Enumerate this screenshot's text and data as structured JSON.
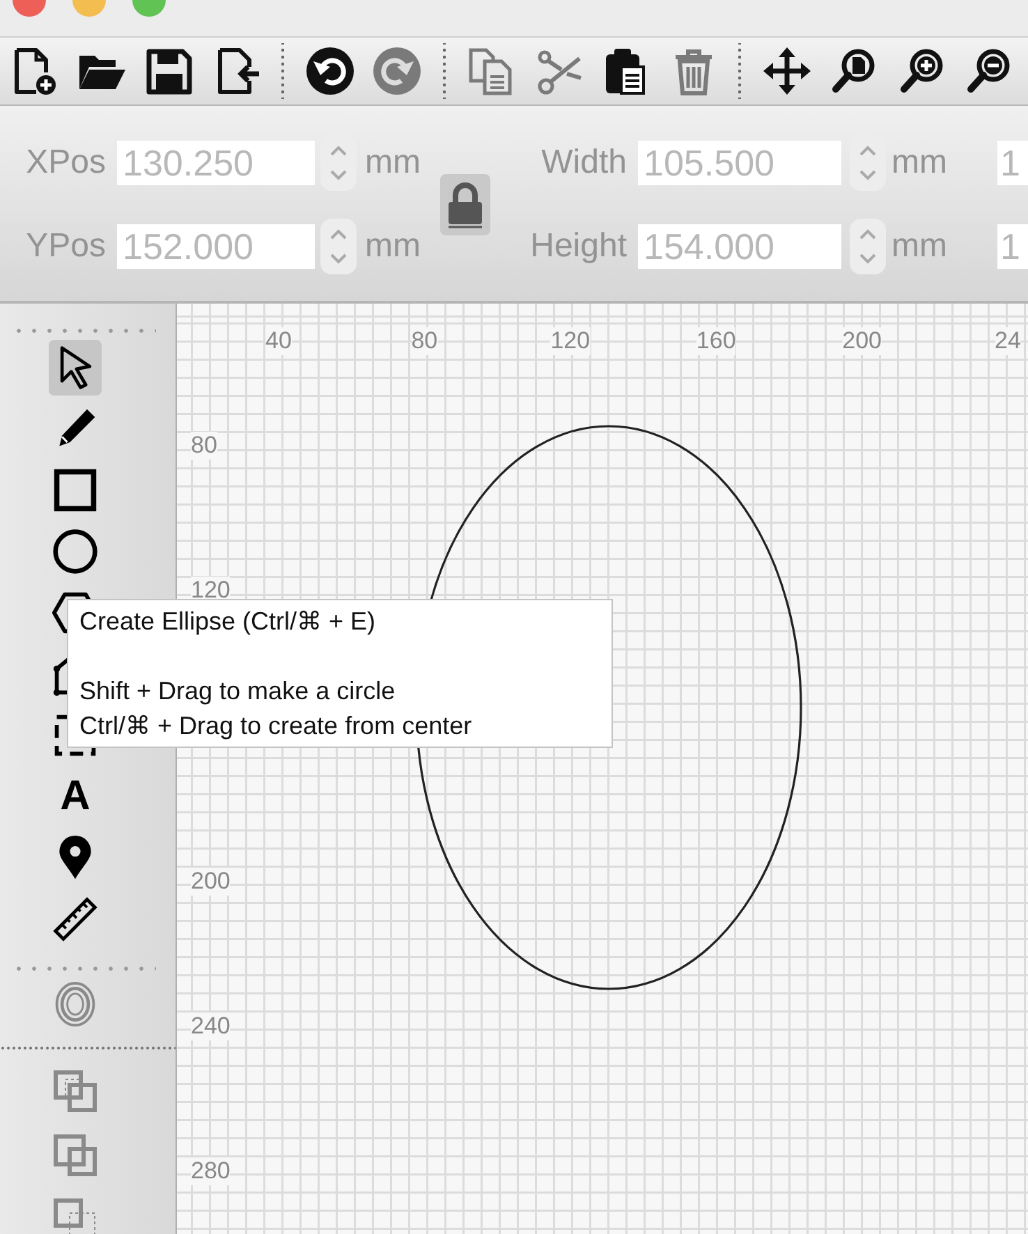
{
  "toolbar": [
    [
      {
        "disabled": false
      },
      {
        "disabled": false
      },
      {
        "disabled": false
      },
      {
        "disabled": false
      }
    ],
    [
      {
        "disabled": false
      },
      {
        "disabled": true
      }
    ],
    [
      {
        "disabled": true
      },
      {
        "disabled": true
      },
      {
        "disabled": false
      },
      {
        "disabled": true
      }
    ],
    [
      {
        "disabled": false
      },
      {
        "disabled": false
      },
      {
        "disabled": false
      },
      {
        "disabled": false
      }
    ]
  ],
  "properties": {
    "disabled": true,
    "position": [
      {
        "label": "XPos",
        "value": "130.250",
        "unit": "mm"
      },
      {
        "label": "YPos",
        "value": "152.000",
        "unit": "mm"
      }
    ],
    "lock": {
      "locked": true
    },
    "size": [
      {
        "label": "Width",
        "value": "105.500",
        "unit": "mm"
      },
      {
        "label": "Height",
        "value": "154.000",
        "unit": "mm"
      }
    ],
    "column_3": [
      {
        "value": "1"
      },
      {
        "value": "1"
      }
    ]
  },
  "tools": [
    {
      "selected": true
    },
    {
      "selected": false
    },
    {
      "selected": false
    },
    {
      "selected": false
    },
    {
      "selected": false
    },
    {
      "selected": false
    },
    {
      "selected": false
    },
    {
      "selected": false,
      "glyph": "A"
    },
    {
      "selected": false
    },
    {
      "selected": false
    }
  ],
  "fill_tools": [
    {
      "disabled": true
    }
  ],
  "layer_tools": [
    {
      "disabled": true
    },
    {
      "disabled": true
    },
    {
      "disabled": true
    }
  ],
  "canvas": {
    "x_ticks": [
      "40",
      "80",
      "120",
      "160",
      "200",
      "24"
    ],
    "y_ticks": [
      "80",
      "120",
      "200",
      "240",
      "280"
    ]
  },
  "tooltip": {
    "title": "Create Ellipse (Ctrl/⌘ + E)",
    "lines": [
      "Shift + Drag to make a circle",
      "Ctrl/⌘ + Drag to create from center"
    ]
  }
}
